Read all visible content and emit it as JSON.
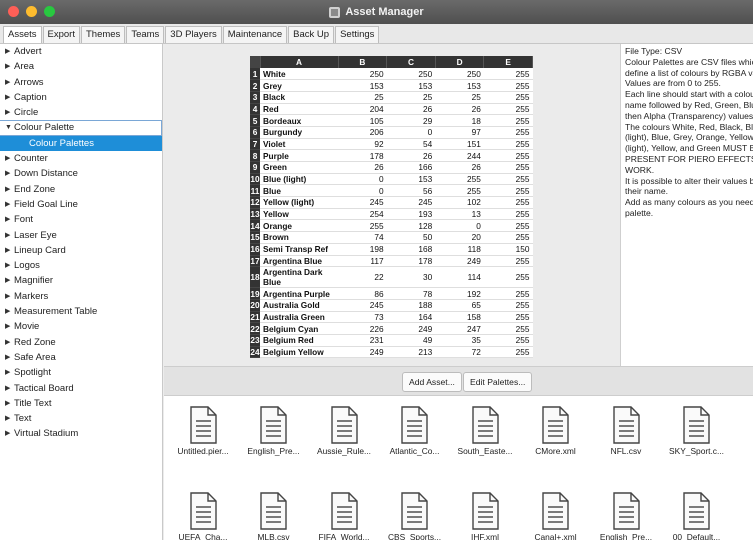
{
  "window": {
    "title": "Asset Manager"
  },
  "tabs": [
    "Assets",
    "Export",
    "Themes",
    "Teams",
    "3D Players",
    "Maintenance",
    "Back Up",
    "Settings"
  ],
  "sidebar": {
    "items": [
      {
        "label": "Advert",
        "state": "collapsed"
      },
      {
        "label": "Area",
        "state": "collapsed"
      },
      {
        "label": "Arrows",
        "state": "collapsed"
      },
      {
        "label": "Caption",
        "state": "collapsed"
      },
      {
        "label": "Circle",
        "state": "collapsed"
      },
      {
        "label": "Colour Palette",
        "state": "expanded"
      },
      {
        "label": "Colour Palettes",
        "state": "child-selected"
      },
      {
        "label": "Counter",
        "state": "collapsed"
      },
      {
        "label": "Down Distance",
        "state": "collapsed"
      },
      {
        "label": "End Zone",
        "state": "collapsed"
      },
      {
        "label": "Field Goal Line",
        "state": "collapsed"
      },
      {
        "label": "Font",
        "state": "collapsed"
      },
      {
        "label": "Laser Eye",
        "state": "collapsed"
      },
      {
        "label": "Lineup Card",
        "state": "collapsed"
      },
      {
        "label": "Logos",
        "state": "collapsed"
      },
      {
        "label": "Magnifier",
        "state": "collapsed"
      },
      {
        "label": "Markers",
        "state": "collapsed"
      },
      {
        "label": "Measurement Table",
        "state": "collapsed"
      },
      {
        "label": "Movie",
        "state": "collapsed"
      },
      {
        "label": "Red Zone",
        "state": "collapsed"
      },
      {
        "label": "Safe Area",
        "state": "collapsed"
      },
      {
        "label": "Spotlight",
        "state": "collapsed"
      },
      {
        "label": "Tactical Board",
        "state": "collapsed"
      },
      {
        "label": "Title Text",
        "state": "collapsed"
      },
      {
        "label": "Text",
        "state": "collapsed"
      },
      {
        "label": "Virtual Stadium",
        "state": "collapsed"
      }
    ]
  },
  "sheet": {
    "columns": [
      "A",
      "B",
      "C",
      "D",
      "E"
    ],
    "rows": [
      [
        "1",
        "White",
        "250",
        "250",
        "250",
        "255"
      ],
      [
        "2",
        "Grey",
        "153",
        "153",
        "153",
        "255"
      ],
      [
        "3",
        "Black",
        "25",
        "25",
        "25",
        "255"
      ],
      [
        "4",
        "Red",
        "204",
        "26",
        "26",
        "255"
      ],
      [
        "5",
        "Bordeaux",
        "105",
        "29",
        "18",
        "255"
      ],
      [
        "6",
        "Burgundy",
        "206",
        "0",
        "97",
        "255"
      ],
      [
        "7",
        "Violet",
        "92",
        "54",
        "151",
        "255"
      ],
      [
        "8",
        "Purple",
        "178",
        "26",
        "244",
        "255"
      ],
      [
        "9",
        "Green",
        "26",
        "166",
        "26",
        "255"
      ],
      [
        "10",
        "Blue (light)",
        "0",
        "153",
        "255",
        "255"
      ],
      [
        "11",
        "Blue",
        "0",
        "56",
        "255",
        "255"
      ],
      [
        "12",
        "Yellow (light)",
        "245",
        "245",
        "102",
        "255"
      ],
      [
        "13",
        "Yellow",
        "254",
        "193",
        "13",
        "255"
      ],
      [
        "14",
        "Orange",
        "255",
        "128",
        "0",
        "255"
      ],
      [
        "15",
        "Brown",
        "74",
        "50",
        "20",
        "255"
      ],
      [
        "16",
        "Semi Transp Ref",
        "198",
        "168",
        "118",
        "150"
      ],
      [
        "17",
        "Argentina Blue",
        "117",
        "178",
        "249",
        "255"
      ],
      [
        "18",
        "Argentina Dark Blue",
        "22",
        "30",
        "114",
        "255"
      ],
      [
        "19",
        "Argentina Purple",
        "86",
        "78",
        "192",
        "255"
      ],
      [
        "20",
        "Australia Gold",
        "245",
        "188",
        "65",
        "255"
      ],
      [
        "21",
        "Australia Green",
        "73",
        "164",
        "158",
        "255"
      ],
      [
        "22",
        "Belgium Cyan",
        "226",
        "249",
        "247",
        "255"
      ],
      [
        "23",
        "Belgium Red",
        "231",
        "49",
        "35",
        "255"
      ],
      [
        "24",
        "Belgium Yellow",
        "249",
        "213",
        "72",
        "255"
      ]
    ]
  },
  "info": {
    "lines": [
      "File Type: CSV",
      "Colour Palettes are CSV files which",
      "define a list of colours by RGBA values.",
      "Values are from 0 to 255.",
      "Each line should start with a colour",
      "name followed by Red, Green, Blue,",
      "then Alpha (Transparency) values.",
      "The colours White, Red, Black, Blue",
      "(light), Blue, Grey, Orange, Yellow",
      "(light), Yellow, and Green MUST BE",
      "PRESENT FOR PIERO EFFECTS TO",
      "WORK.",
      "It is possible to alter their values but n",
      "their name.",
      "Add as many colours as you need per",
      "palette."
    ]
  },
  "buttons": {
    "add_asset": "Add Asset...",
    "edit_palettes": "Edit Palettes..."
  },
  "files": [
    "Untitled.pier...",
    "English_Pre...",
    "Aussie_Rule...",
    "Atlantic_Co...",
    "South_Easte...",
    "CMore.xml",
    "NFL.csv",
    "SKY_Sport.c...",
    "UEFA_Cha...",
    "MLB.csv",
    "FIFA_World...",
    "CBS_Sports...",
    "IHF.xml",
    "Canal+.xml",
    "English_Pre...",
    "00_Default..."
  ],
  "icons": {
    "file": "document-icon",
    "expand": "triangle-right-icon",
    "collapse": "triangle-down-icon"
  },
  "colors": {
    "selection": "#1e8ed8",
    "header": "#333333"
  }
}
